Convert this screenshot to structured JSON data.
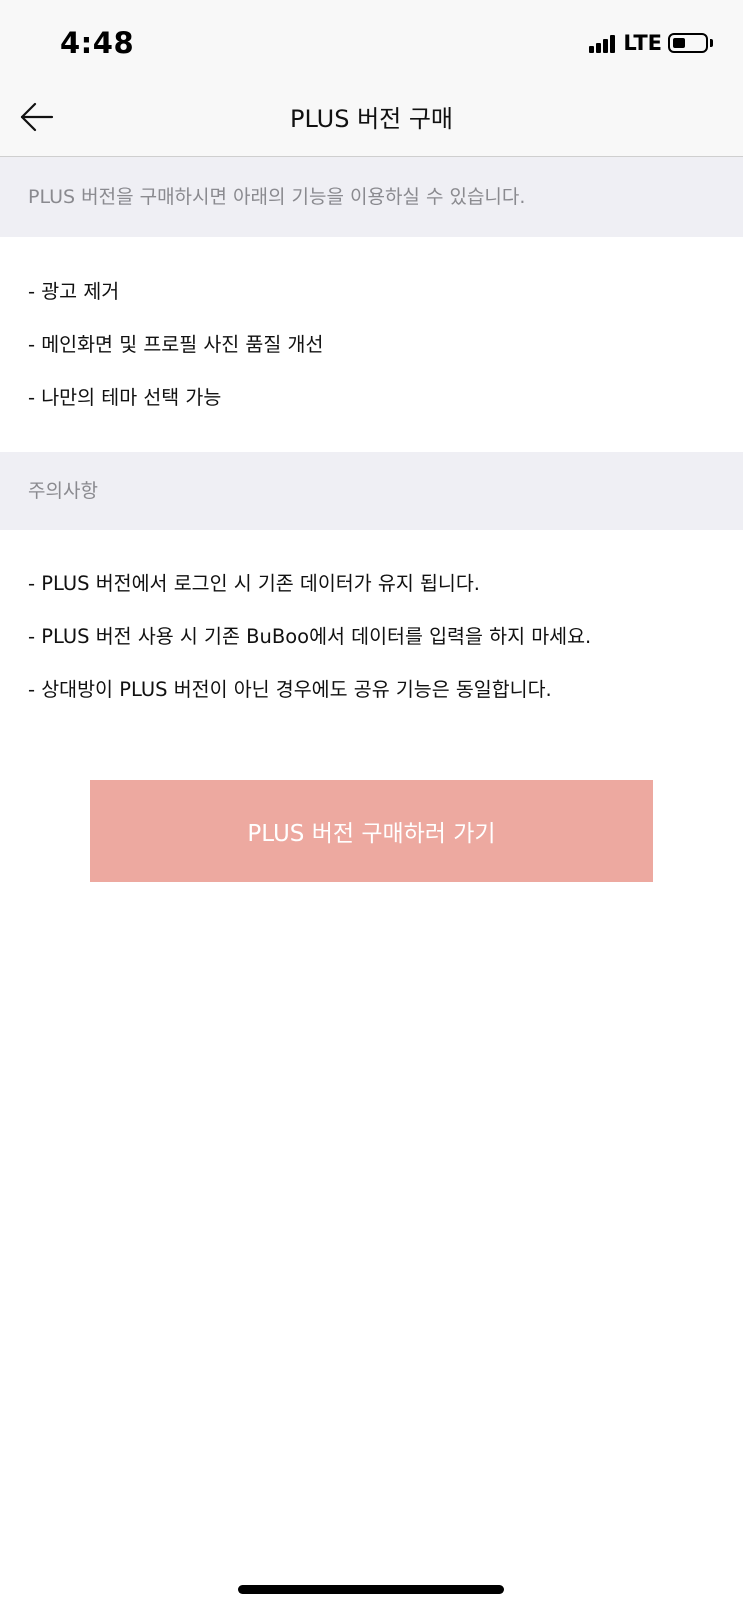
{
  "status_bar": {
    "time": "4:48",
    "network": "LTE",
    "battery_level": 0.4,
    "icons": [
      "signal-icon",
      "battery-icon"
    ]
  },
  "nav": {
    "back_icon": "arrow-left-icon",
    "title": "PLUS 버전 구매"
  },
  "intro": {
    "text": "PLUS 버전을 구매하시면 아래의 기능을 이용하실 수 있습니다."
  },
  "features": [
    "- 광고 제거",
    "- 메인화면 및 프로필 사진 품질 개선",
    "- 나만의 테마 선택 가능"
  ],
  "caution": {
    "title": "주의사항",
    "items": [
      "- PLUS 버전에서 로그인 시 기존 데이터가 유지 됩니다.",
      "- PLUS 버전 사용 시 기존 BuBoo에서 데이터를 입력을 하지 마세요.",
      "- 상대방이 PLUS 버전이 아닌 경우에도 공유 기능은 동일합니다."
    ]
  },
  "purchase_button": {
    "label": "PLUS 버전 구매하러 가기"
  },
  "colors": {
    "accent": "#eda9a0",
    "section_background": "#efeff4",
    "secondary_text": "#8a8a8f",
    "bar_background": "#f8f8f8"
  }
}
